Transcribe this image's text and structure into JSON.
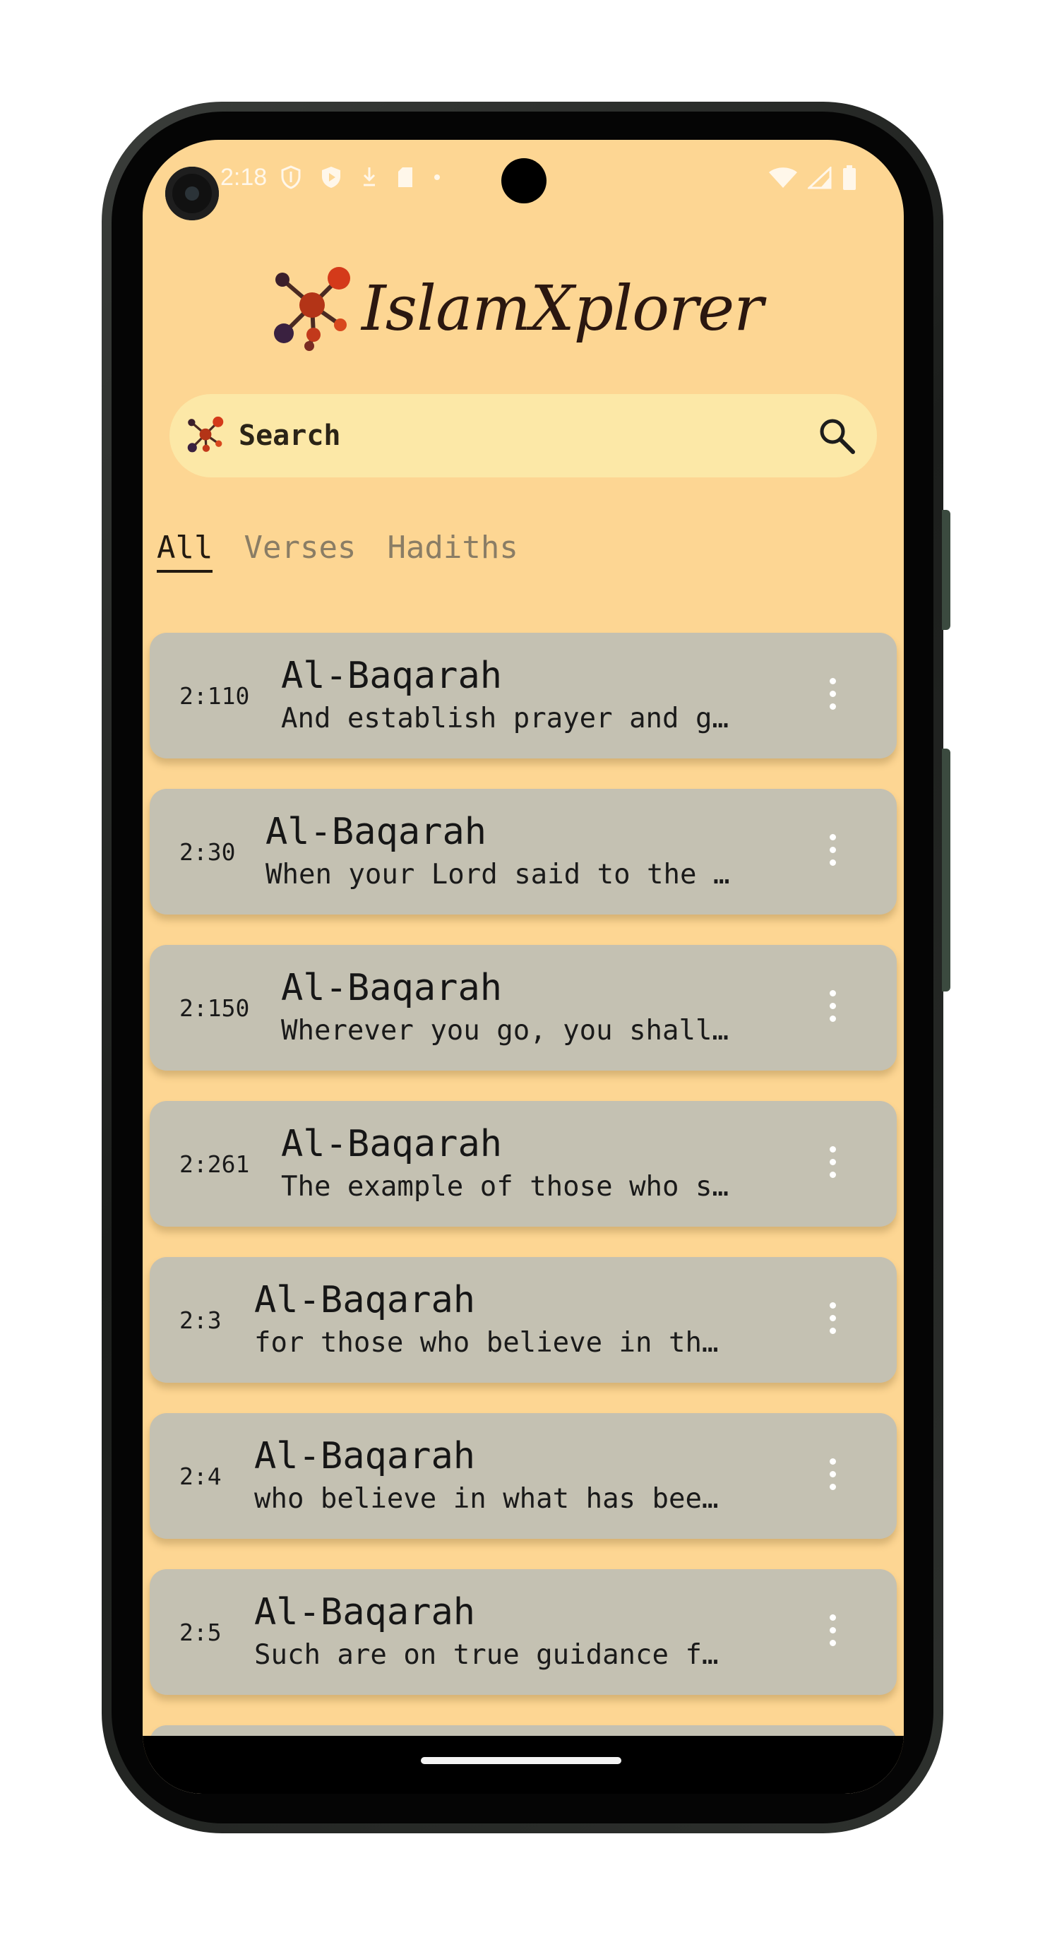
{
  "status_bar": {
    "time": "2:18",
    "icons": [
      "shield-icon",
      "play-shield-icon",
      "download-icon",
      "sd-card-icon",
      "dot-icon"
    ],
    "right_icons": [
      "wifi-icon",
      "signal-icon",
      "battery-icon"
    ]
  },
  "app": {
    "title": "IslamXplorer"
  },
  "search": {
    "placeholder": "Search"
  },
  "tabs": [
    {
      "label": "All",
      "active": true
    },
    {
      "label": "Verses",
      "active": false
    },
    {
      "label": "Hadiths",
      "active": false
    }
  ],
  "results": [
    {
      "ref": "2:110",
      "title": "Al-Baqarah",
      "snippet": "And establish prayer and g…"
    },
    {
      "ref": "2:30",
      "title": "Al-Baqarah",
      "snippet": "When your Lord said to the …"
    },
    {
      "ref": "2:150",
      "title": "Al-Baqarah",
      "snippet": "Wherever you go, you shall…"
    },
    {
      "ref": "2:261",
      "title": "Al-Baqarah",
      "snippet": "The example of those who s…"
    },
    {
      "ref": "2:3",
      "title": "Al-Baqarah",
      "snippet": "for those who believe in th…"
    },
    {
      "ref": "2:4",
      "title": "Al-Baqarah",
      "snippet": "who believe in what has bee…"
    },
    {
      "ref": "2:5",
      "title": "Al-Baqarah",
      "snippet": "Such are on true guidance f…"
    }
  ],
  "colors": {
    "background": "#fdd693",
    "search_bg": "#fce8a7",
    "card_bg": "#c4c1b2",
    "logo_accent": "#d43a1a",
    "logo_dark": "#3b1f2b"
  }
}
